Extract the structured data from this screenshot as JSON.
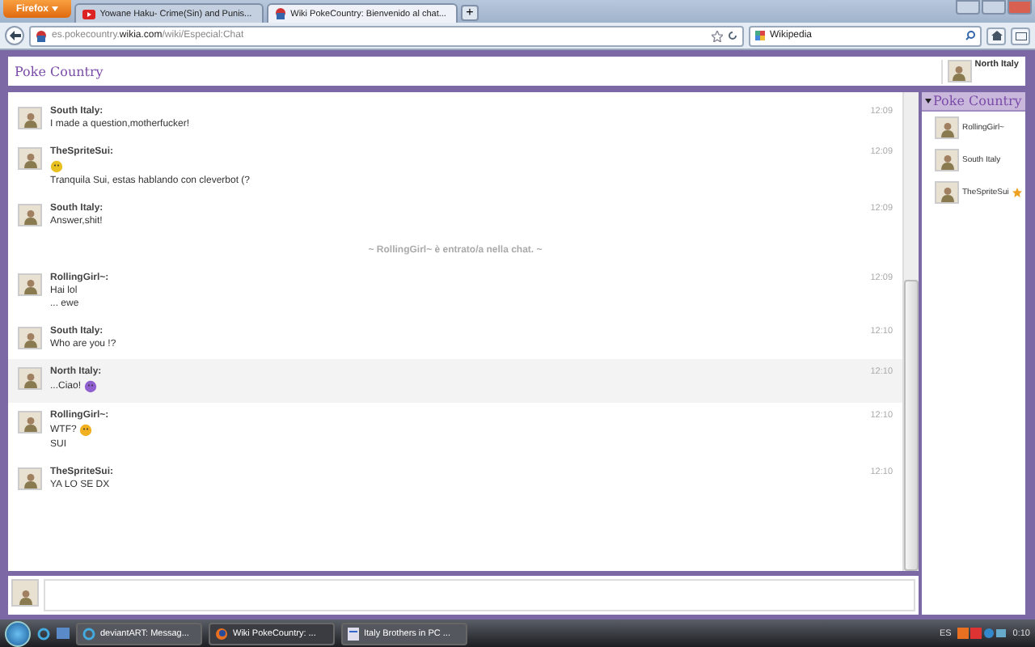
{
  "browser": {
    "menu_button": "Firefox",
    "tabs": [
      {
        "label": "Yowane Haku- Crime(Sin) and Punis...",
        "selected": false,
        "kind": "video"
      },
      {
        "label": "Wiki PokeCountry: Bienvenido al chat...",
        "selected": true,
        "kind": "wiki"
      }
    ],
    "new_tab": "+",
    "url": {
      "host_pre": "es.pokecountry.",
      "host": "wikia.com",
      "path": "/wiki/Especial:Chat"
    },
    "search": {
      "value": "Wikipedia"
    }
  },
  "header": {
    "title": "Poke Country",
    "user": "North Italy"
  },
  "messages": [
    {
      "kind": "message",
      "user": "South Italy:",
      "time": "12:09",
      "self": false,
      "lines": [
        {
          "text": "I made a question,motherfucker!"
        }
      ]
    },
    {
      "kind": "message",
      "user": "TheSpriteSui:",
      "time": "12:09",
      "self": false,
      "lines": [
        {
          "color": "#e8c020"
        },
        {
          "text": "Tranquila Sui, estas hablando con cleverbot (?"
        }
      ]
    },
    {
      "kind": "message",
      "user": "South Italy:",
      "time": "12:09",
      "self": false,
      "lines": [
        {
          "text": "Answer,shit!"
        }
      ]
    },
    {
      "kind": "notice",
      "text": "~ RollingGirl~ è entrato/a nella chat. ~"
    },
    {
      "kind": "message",
      "user": "RollingGirl~:",
      "time": "12:09",
      "self": false,
      "lines": [
        {
          "text": "Hai lol"
        },
        {
          "text": "... ewe"
        }
      ]
    },
    {
      "kind": "message",
      "user": "South Italy:",
      "time": "12:10",
      "self": false,
      "lines": [
        {
          "text": "Who are you !?"
        }
      ]
    },
    {
      "kind": "message",
      "user": "North Italy:",
      "time": "12:10",
      "self": true,
      "lines": [
        {
          "text": "...Ciao!",
          "color": "#9060d0"
        }
      ]
    },
    {
      "kind": "message",
      "user": "RollingGirl~:",
      "time": "12:10",
      "self": false,
      "lines": [
        {
          "text": "WTF?",
          "color": "#f0b020"
        },
        {
          "text": "SUI"
        }
      ]
    },
    {
      "kind": "message",
      "user": "TheSpriteSui:",
      "time": "12:10",
      "self": false,
      "lines": [
        {
          "text": "YA LO SE DX"
        }
      ]
    }
  ],
  "sidebar": {
    "title": "Poke Country",
    "expanded": true,
    "users": [
      {
        "name": "RollingGirl~",
        "star": false
      },
      {
        "name": "South Italy",
        "star": false
      },
      {
        "name": "TheSpriteSui",
        "star": true
      }
    ]
  },
  "taskbar": {
    "tasks": [
      {
        "label": "deviantART: Messag...",
        "selected": false,
        "kind": "ie"
      },
      {
        "label": "Wiki PokeCountry: ...",
        "selected": true,
        "kind": "firefox"
      },
      {
        "label": "Italy Brothers in PC ...",
        "selected": false,
        "kind": "doc"
      }
    ],
    "language": "ES",
    "clock": "0:10"
  }
}
